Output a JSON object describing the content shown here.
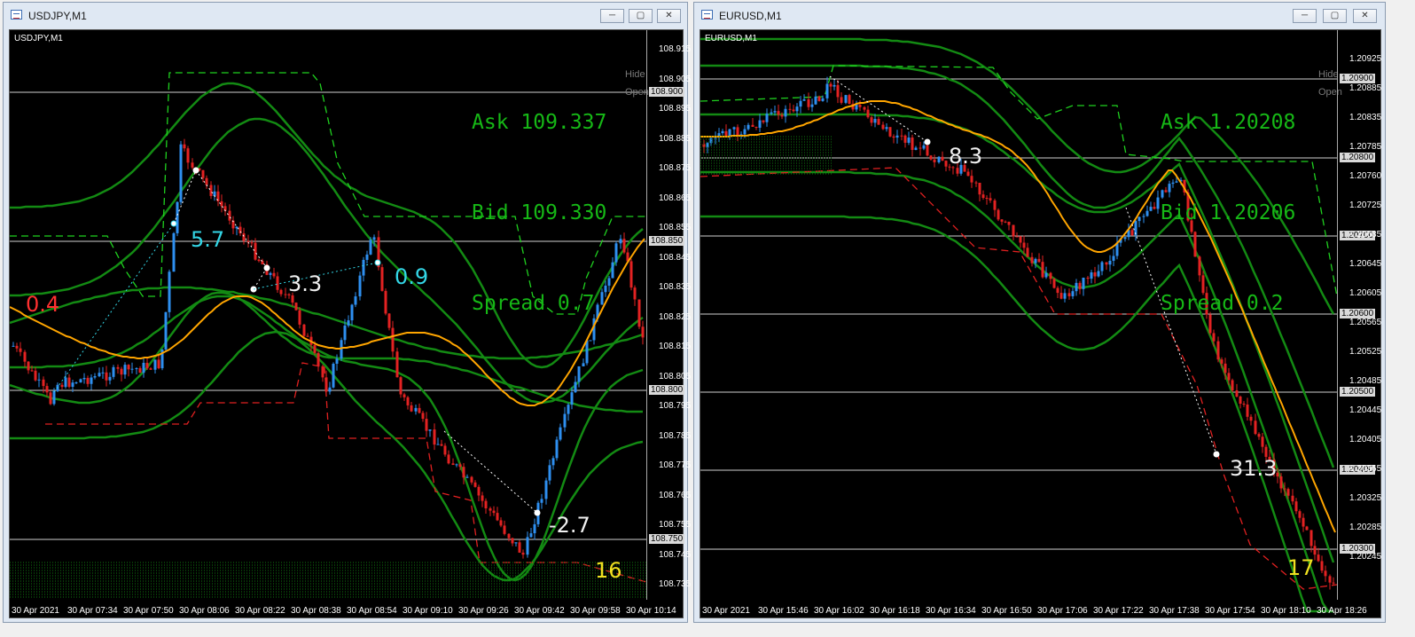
{
  "windows": [
    {
      "title": "USDJPY,M1",
      "symbol_label": "USDJPY,M1",
      "ask": "Ask 109.337",
      "bid": "Bid 109.330",
      "spread": "Spread 0.7",
      "hide": "Hide",
      "open": "Open",
      "price_ticks": [
        "108.915",
        "108.905",
        "108.895",
        "108.885",
        "108.875",
        "108.865",
        "108.855",
        "108.845",
        "108.835",
        "108.825",
        "108.815",
        "108.805",
        "108.795",
        "108.785",
        "108.775",
        "108.765",
        "108.755",
        "108.745",
        "108.735"
      ],
      "boxed_levels": [
        "108.900",
        "108.850",
        "108.800",
        "108.750"
      ],
      "time_ticks": [
        "30 Apr 2021",
        "30 Apr 07:34",
        "30 Apr 07:50",
        "30 Apr 08:06",
        "30 Apr 08:22",
        "30 Apr 08:38",
        "30 Apr 08:54",
        "30 Apr 09:10",
        "30 Apr 09:26",
        "30 Apr 09:42",
        "30 Apr 09:58",
        "30 Apr 10:14"
      ],
      "annotations": [
        {
          "text": "0.4",
          "color": "#ff3030"
        },
        {
          "text": "5.7",
          "color": "#33d6e6"
        },
        {
          "text": "3.3",
          "color": "#f0f0f0"
        },
        {
          "text": "0.9",
          "color": "#33d6e6"
        },
        {
          "text": "-2.7",
          "color": "#f0f0f0"
        },
        {
          "text": "16",
          "color": "#f0e020"
        }
      ]
    },
    {
      "title": "EURUSD,M1",
      "symbol_label": "EURUSD,M1",
      "ask": "Ask 1.20208",
      "bid": "Bid 1.20206",
      "spread": "Spread 0.2",
      "hide": "Hide",
      "open": "Open",
      "price_ticks": [
        "1.20925",
        "1.20885",
        "1.20835",
        "1.20785",
        "1.20760",
        "1.20725",
        "1.20685",
        "1.20645",
        "1.20605",
        "1.20565",
        "1.20525",
        "1.20485",
        "1.20445",
        "1.20405",
        "1.20365",
        "1.20325",
        "1.20285",
        "1.20245"
      ],
      "boxed_levels": [
        "1.20900",
        "1.20800",
        "1.20700",
        "1.20600",
        "1.20500",
        "1.20400",
        "1.20300"
      ],
      "time_ticks": [
        "30 Apr 2021",
        "30 Apr 15:46",
        "30 Apr 16:02",
        "30 Apr 16:18",
        "30 Apr 16:34",
        "30 Apr 16:50",
        "30 Apr 17:06",
        "30 Apr 17:22",
        "30 Apr 17:38",
        "30 Apr 17:54",
        "30 Apr 18:10",
        "30 Apr 18:26"
      ],
      "annotations": [
        {
          "text": "8.3",
          "color": "#f0f0f0"
        },
        {
          "text": "31.3",
          "color": "#f0f0f0"
        },
        {
          "text": "17",
          "color": "#f0e020"
        }
      ]
    }
  ],
  "buttons": {
    "minimize": "─",
    "maximize": "▢",
    "close": "✕"
  }
}
